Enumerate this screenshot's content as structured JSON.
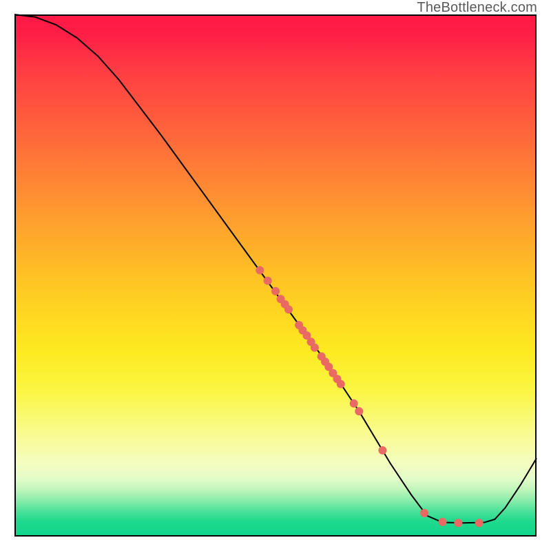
{
  "watermark": "TheBottleneck.com",
  "colors": {
    "curve": "#000000",
    "dot_fill": "#e86a63",
    "dot_stroke": "#b34b45"
  },
  "chart_data": {
    "type": "line",
    "title": "",
    "xlabel": "",
    "ylabel": "",
    "xlim": [
      0,
      100
    ],
    "ylim": [
      0,
      100
    ],
    "curve": [
      {
        "x": 0,
        "y": 100
      },
      {
        "x": 4,
        "y": 99.5
      },
      {
        "x": 8,
        "y": 98
      },
      {
        "x": 12,
        "y": 95.5
      },
      {
        "x": 16,
        "y": 92
      },
      {
        "x": 20,
        "y": 87.5
      },
      {
        "x": 28,
        "y": 77
      },
      {
        "x": 36,
        "y": 66
      },
      {
        "x": 44,
        "y": 55
      },
      {
        "x": 52,
        "y": 44
      },
      {
        "x": 60,
        "y": 33
      },
      {
        "x": 66,
        "y": 24
      },
      {
        "x": 72,
        "y": 14
      },
      {
        "x": 76,
        "y": 8
      },
      {
        "x": 79,
        "y": 4
      },
      {
        "x": 82,
        "y": 2.7
      },
      {
        "x": 86,
        "y": 2.6
      },
      {
        "x": 90,
        "y": 2.7
      },
      {
        "x": 92,
        "y": 3.3
      },
      {
        "x": 94,
        "y": 5.5
      },
      {
        "x": 97,
        "y": 10
      },
      {
        "x": 100,
        "y": 15
      }
    ],
    "dots": [
      {
        "x": 47.0,
        "y": 51.0
      },
      {
        "x": 48.5,
        "y": 49.0
      },
      {
        "x": 50.0,
        "y": 47.0
      },
      {
        "x": 51.0,
        "y": 45.5
      },
      {
        "x": 51.8,
        "y": 44.5
      },
      {
        "x": 52.5,
        "y": 43.5
      },
      {
        "x": 54.5,
        "y": 40.5
      },
      {
        "x": 55.2,
        "y": 39.5
      },
      {
        "x": 56.0,
        "y": 38.5
      },
      {
        "x": 56.8,
        "y": 37.3
      },
      {
        "x": 57.5,
        "y": 36.2
      },
      {
        "x": 58.8,
        "y": 34.5
      },
      {
        "x": 59.5,
        "y": 33.5
      },
      {
        "x": 60.2,
        "y": 32.5
      },
      {
        "x": 61.0,
        "y": 31.3
      },
      {
        "x": 61.8,
        "y": 30.2
      },
      {
        "x": 62.5,
        "y": 29.2
      },
      {
        "x": 65.0,
        "y": 25.5
      },
      {
        "x": 66.0,
        "y": 24.0
      },
      {
        "x": 70.5,
        "y": 16.5
      },
      {
        "x": 78.5,
        "y": 4.5
      },
      {
        "x": 82.0,
        "y": 2.8
      },
      {
        "x": 85.0,
        "y": 2.6
      },
      {
        "x": 89.0,
        "y": 2.6
      }
    ],
    "dot_radius_px": 6
  }
}
